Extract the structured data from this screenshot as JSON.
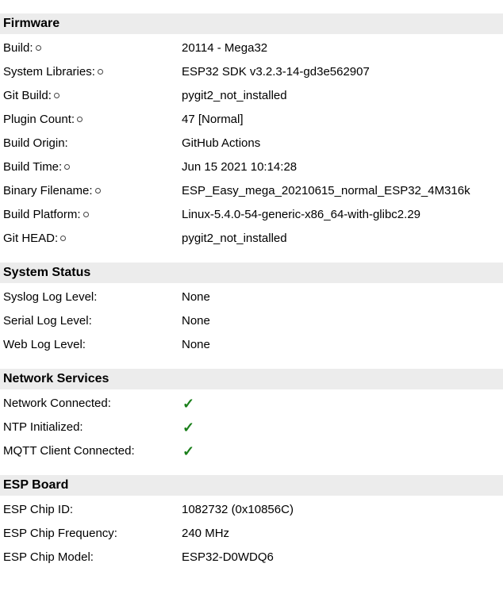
{
  "sections": [
    {
      "title": "Firmware",
      "rows": [
        {
          "label": "Build:",
          "value": "20114 - Mega32",
          "copy": true
        },
        {
          "label": "System Libraries:",
          "value": "ESP32 SDK v3.2.3-14-gd3e562907",
          "copy": true
        },
        {
          "label": "Git Build:",
          "value": "pygit2_not_installed",
          "copy": true
        },
        {
          "label": "Plugin Count:",
          "value": "47 [Normal]",
          "copy": true
        },
        {
          "label": "Build Origin:",
          "value": "GitHub Actions",
          "copy": false
        },
        {
          "label": "Build Time:",
          "value": "Jun 15 2021 10:14:28",
          "copy": true
        },
        {
          "label": "Binary Filename:",
          "value": "ESP_Easy_mega_20210615_normal_ESP32_4M316k",
          "copy": true
        },
        {
          "label": "Build Platform:",
          "value": "Linux-5.4.0-54-generic-x86_64-with-glibc2.29",
          "copy": true
        },
        {
          "label": "Git HEAD:",
          "value": "pygit2_not_installed",
          "copy": true
        }
      ]
    },
    {
      "title": "System Status",
      "rows": [
        {
          "label": "Syslog Log Level:",
          "value": "None",
          "copy": false
        },
        {
          "label": "Serial Log Level:",
          "value": "None",
          "copy": false
        },
        {
          "label": "Web Log Level:",
          "value": "None",
          "copy": false
        }
      ]
    },
    {
      "title": "Network Services",
      "rows": [
        {
          "label": "Network Connected:",
          "value": "✓",
          "copy": false,
          "check": true
        },
        {
          "label": "NTP Initialized:",
          "value": "✓",
          "copy": false,
          "check": true
        },
        {
          "label": "MQTT Client Connected:",
          "value": "✓",
          "copy": false,
          "check": true
        }
      ]
    },
    {
      "title": "ESP Board",
      "rows": [
        {
          "label": "ESP Chip ID:",
          "value": "1082732 (0x10856C)",
          "copy": false
        },
        {
          "label": "ESP Chip Frequency:",
          "value": "240 MHz",
          "copy": false
        },
        {
          "label": "ESP Chip Model:",
          "value": "ESP32-D0WDQ6",
          "copy": false
        }
      ]
    }
  ],
  "colors": {
    "header_bg": "#ececec",
    "check": "#1a7f1a"
  },
  "icons": {
    "copy": "copy-icon",
    "check": "checkmark-icon"
  }
}
